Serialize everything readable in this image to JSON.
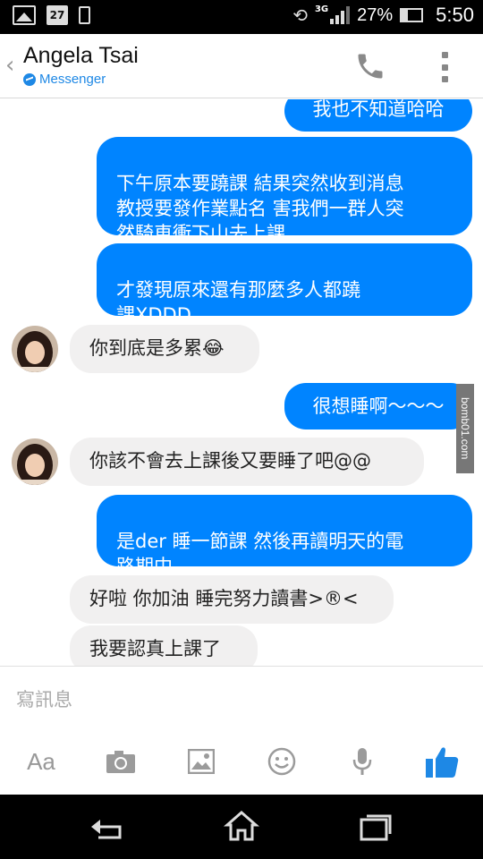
{
  "status_bar": {
    "calendar_day": "27",
    "network": "3G",
    "battery": "27%",
    "time": "5:50"
  },
  "header": {
    "title": "Angela Tsai",
    "subtitle": "Messenger"
  },
  "messages": [
    {
      "side": "out",
      "text": "我也不知道哈哈"
    },
    {
      "side": "out",
      "text": "下午原本要蹺課 結果突然收到消息\n教授要發作業點名 害我們一群人突\n然騎車衝下山去上課"
    },
    {
      "side": "out",
      "text": "才發現原來還有那麼多人都蹺\n課XDDD"
    },
    {
      "side": "in",
      "text": "你到底是多累😂"
    },
    {
      "side": "out",
      "text": "很想睡啊～～～"
    },
    {
      "side": "in",
      "text": "你該不會去上課後又要睡了吧@@"
    },
    {
      "side": "out",
      "text": "是der 睡一節課 然後再讀明天的電\n路期中"
    },
    {
      "side": "in",
      "text": "好啦 你加油 睡完努力讀書>®<"
    },
    {
      "side": "in",
      "text": "我要認真上課了"
    }
  ],
  "watermark": "bomb01.com",
  "compose": {
    "placeholder": "寫訊息",
    "text_tool_label": "Aa"
  },
  "colors": {
    "accent": "#0084ff",
    "incoming_bubble": "#f1f0f0",
    "brand": "#1e88e5"
  }
}
